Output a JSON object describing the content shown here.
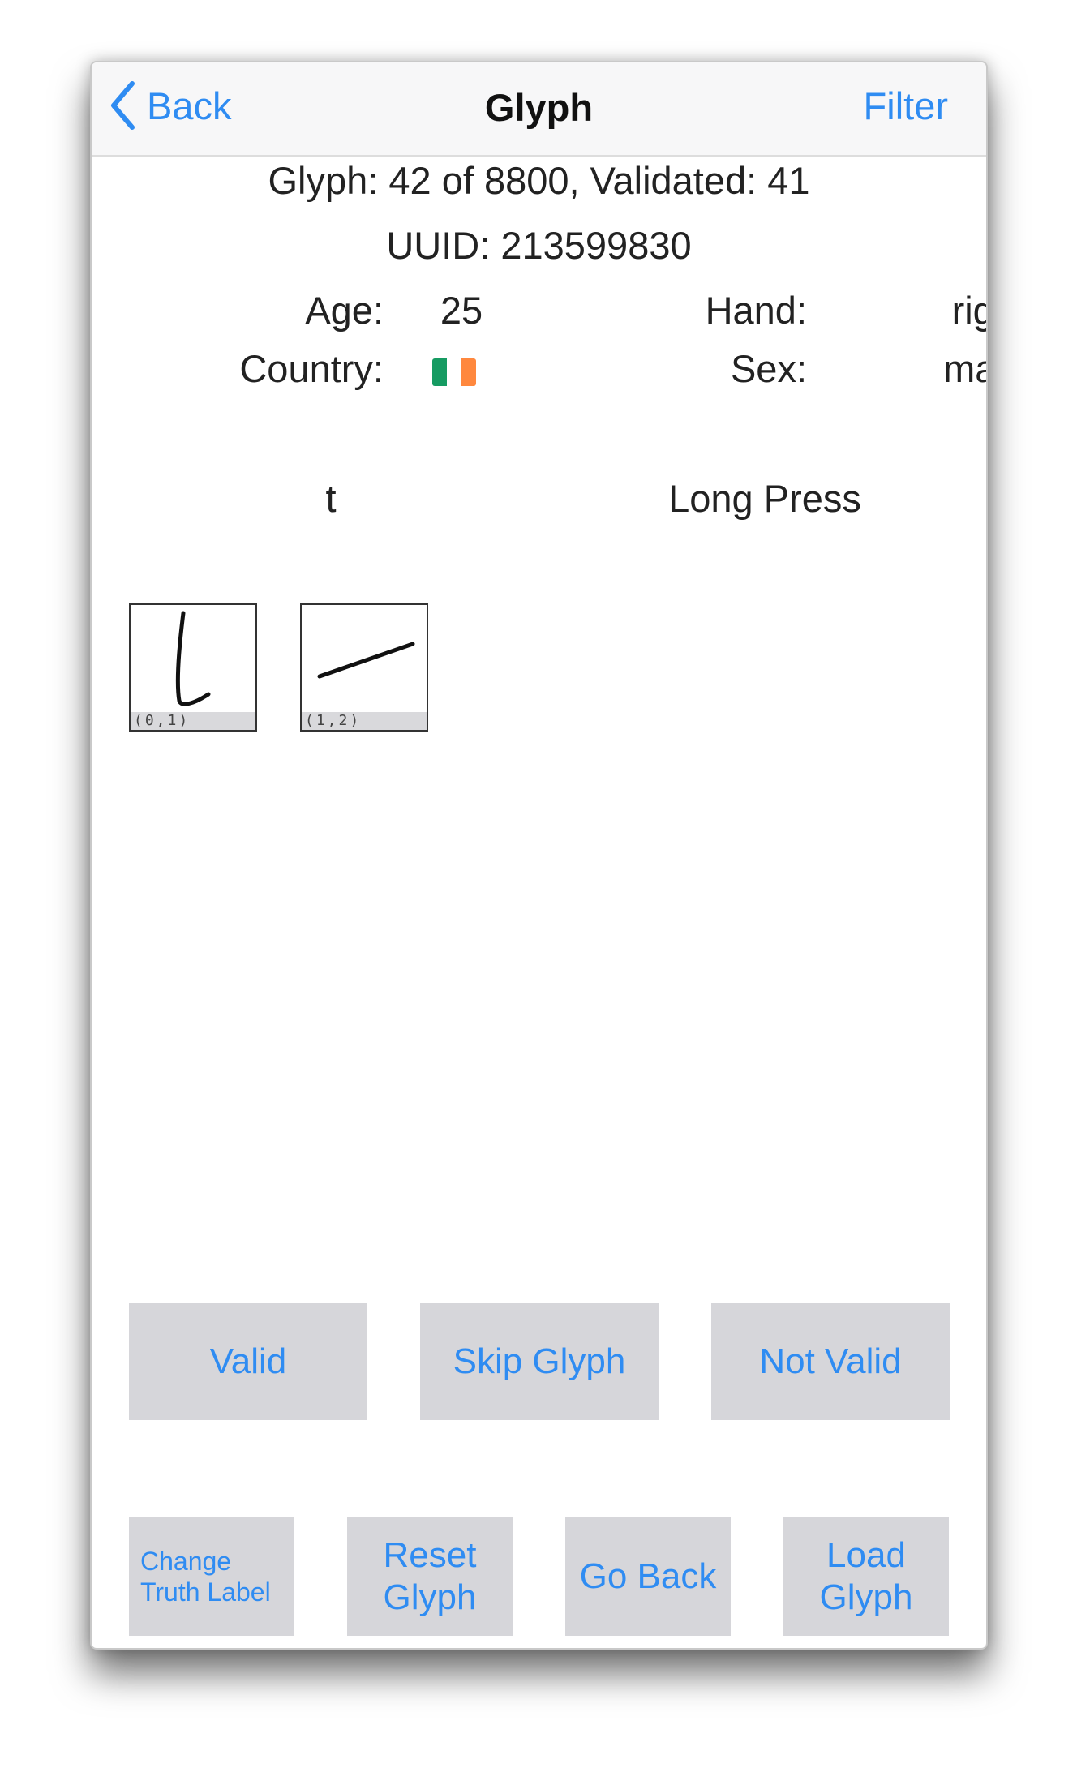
{
  "nav": {
    "back_label": "Back",
    "title": "Glyph",
    "filter_label": "Filter"
  },
  "info": {
    "progress": "Glyph: 42 of 8800, Validated: 41",
    "uuid": "UUID: 213599830",
    "age_label": "Age:",
    "age_value": "25",
    "hand_label": "Hand:",
    "hand_value": "right",
    "country_label": "Country:",
    "country_flag": "ireland-flag-icon",
    "sex_label": "Sex:",
    "sex_value": "male"
  },
  "glyph": {
    "character": "t",
    "gesture": "Long Press",
    "strokes": [
      {
        "label": "(0,1)"
      },
      {
        "label": "(1,2)"
      }
    ]
  },
  "actions": {
    "valid": "Valid",
    "skip": "Skip Glyph",
    "not_valid": "Not Valid"
  },
  "tools": {
    "change_line1": "Change",
    "change_line2": "Truth Label",
    "reset_line1": "Reset",
    "reset_line2": "Glyph",
    "go_back": "Go Back",
    "load_line1": "Load",
    "load_line2": "Glyph"
  },
  "colors": {
    "accent": "#2f8cf2",
    "button_bg": "#d6d6da",
    "flag_green": "#169b62",
    "flag_white": "#ffffff",
    "flag_orange": "#ff883e"
  }
}
